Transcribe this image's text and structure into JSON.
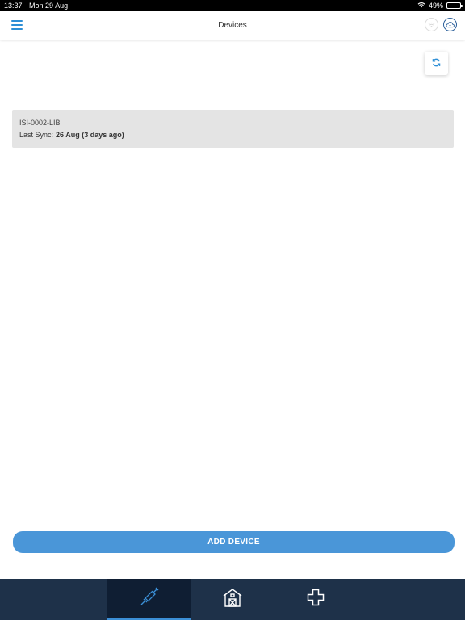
{
  "status_bar": {
    "time": "13:37",
    "date": "Mon 29 Aug",
    "battery": "49%",
    "battery_level": 0.49
  },
  "header": {
    "title": "Devices"
  },
  "devices": [
    {
      "name": "ISI-0002-LIB",
      "last_sync_label": "Last Sync:",
      "last_sync_value": "26 Aug (3 days ago)"
    }
  ],
  "actions": {
    "add_device": "ADD DEVICE"
  },
  "colors": {
    "accent": "#4a96d8",
    "tabbar": "#1e3149",
    "tab_active": "#0f1e33",
    "card": "#e4e4e4"
  },
  "tabs": [
    {
      "icon": "syringe-icon",
      "active": true
    },
    {
      "icon": "barn-icon",
      "active": false
    },
    {
      "icon": "medical-cross-icon",
      "active": false
    }
  ]
}
